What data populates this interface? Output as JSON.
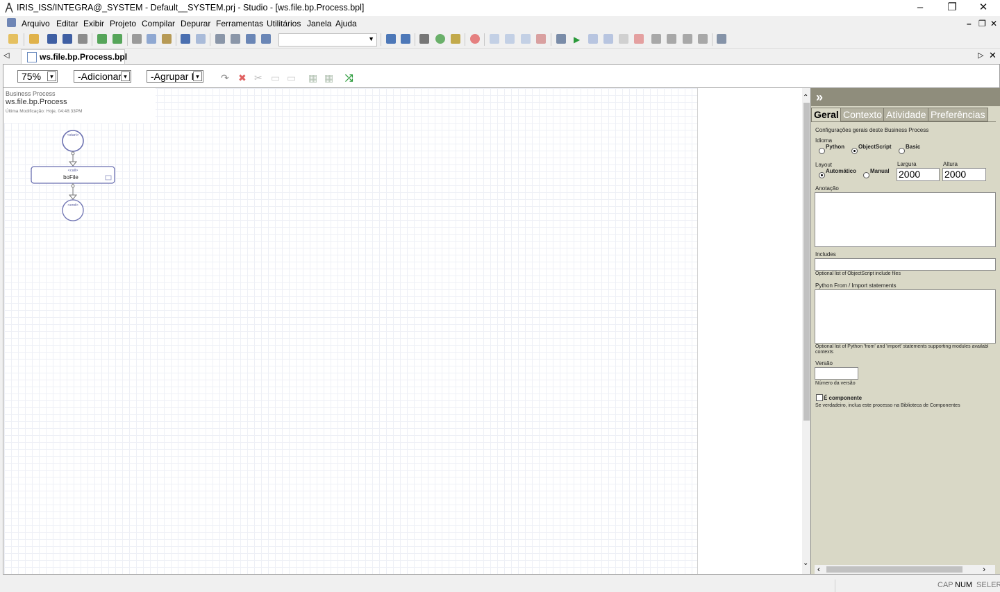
{
  "window": {
    "title": "IRIS_ISS/INTEGRA@_SYSTEM - Default__SYSTEM.prj - Studio - [ws.file.bp.Process.bpl]"
  },
  "menu": [
    "Arquivo",
    "Editar",
    "Exibir",
    "Projeto",
    "Compilar",
    "Depurar",
    "Ferramentas",
    "Utilitários",
    "Janela",
    "Ajuda"
  ],
  "tab": {
    "label": "ws.file.bp.Process.bpl"
  },
  "diagram_toolbar": {
    "zoom": "75%",
    "add": "-Adicionar",
    "group": "-Agrupar It"
  },
  "info": {
    "type": "Business Process",
    "name": "ws.file.bp.Process",
    "modified": "Última Modificação: Hoje, 04:48:33PM"
  },
  "diagram": {
    "start": "<start>",
    "call_tag": "<call>",
    "call_name": "boFile",
    "end": "<end>"
  },
  "panel": {
    "tabs": [
      "Geral",
      "Contexto",
      "Atividade",
      "Preferências"
    ],
    "desc": "Configurações gerais deste Business Process",
    "idioma_label": "Idioma",
    "idioma_options": [
      "Python",
      "ObjectScript",
      "Basic"
    ],
    "idioma_selected": "ObjectScript",
    "layout_label": "Layout",
    "layout_options": [
      "Automático",
      "Manual"
    ],
    "layout_selected": "Automático",
    "largura_label": "Largura",
    "largura_value": "2000",
    "altura_label": "Altura",
    "altura_value": "2000",
    "anotacao_label": "Anotação",
    "includes_label": "Includes",
    "includes_help": "Optional list of ObjectScript include files",
    "python_label": "Python From / Import statements",
    "python_help": "Optional list of Python 'from' and 'import' statements supporting modules availabl contexts",
    "versao_label": "Versão",
    "versao_help": "Número da versão",
    "componente_label": "É componente",
    "componente_help": "Se verdadeiro, inclua este processo na Biblioteca de Componentes"
  },
  "status": {
    "cap": "CAP",
    "num": "NUM",
    "se": "SE",
    "ler": "LER"
  }
}
